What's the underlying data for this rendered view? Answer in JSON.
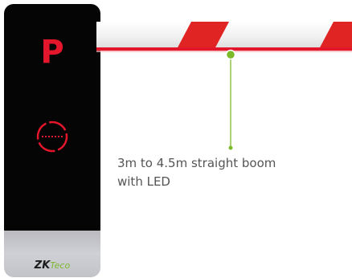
{
  "cabinet": {
    "parking_letter": "P",
    "brand": {
      "prefix": "ZK",
      "suffix": "Teco"
    }
  },
  "callout": {
    "lines": [
      "3m to 4.5m straight boom",
      "with LED"
    ]
  },
  "colors": {
    "cabinet_body": "#050505",
    "led_red": "#e3162c",
    "boom_white": "#f2f2f2",
    "boom_stripe": "#e02424",
    "leader_green": "#7cba2a",
    "caption_text": "#555555",
    "base_grey": "#c6c7cd"
  },
  "icons": [
    "no-entry-ring-icon",
    "leader-dot-icon"
  ]
}
